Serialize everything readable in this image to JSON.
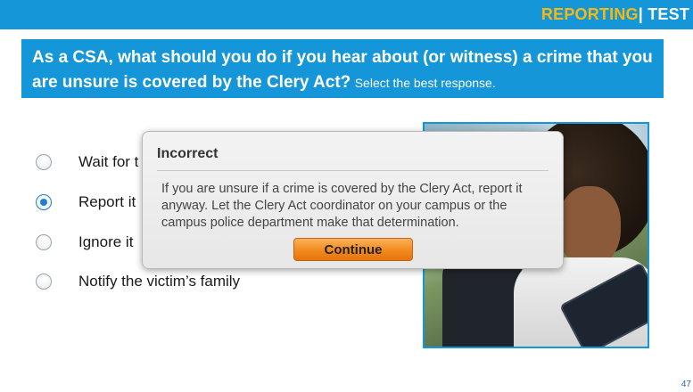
{
  "header": {
    "brand_primary": "REPORTING",
    "brand_separator": "|",
    "brand_secondary": "TEST"
  },
  "question": {
    "text": "As a CSA, what should you do if you hear about (or witness) a crime that you are unsure is covered by the Clery Act?",
    "hint": "Select the best response."
  },
  "options": [
    {
      "label": "Wait for t",
      "selected": false
    },
    {
      "label": "Report it",
      "selected": true
    },
    {
      "label": "Ignore it",
      "selected": false
    },
    {
      "label": "Notify the victim’s family",
      "selected": false
    }
  ],
  "dialog": {
    "title": "Incorrect",
    "body": "If you are unsure if a crime is covered by the Clery Act, report it anyway. Let the Clery Act coordinator on your campus or the campus police department make that determination.",
    "button_label": "Continue"
  },
  "page_number": "47",
  "colors": {
    "banner": "#1496d8",
    "brand_accent": "#f7b90f",
    "button": "#f28a1e",
    "radio_selected": "#1f7ed1"
  }
}
